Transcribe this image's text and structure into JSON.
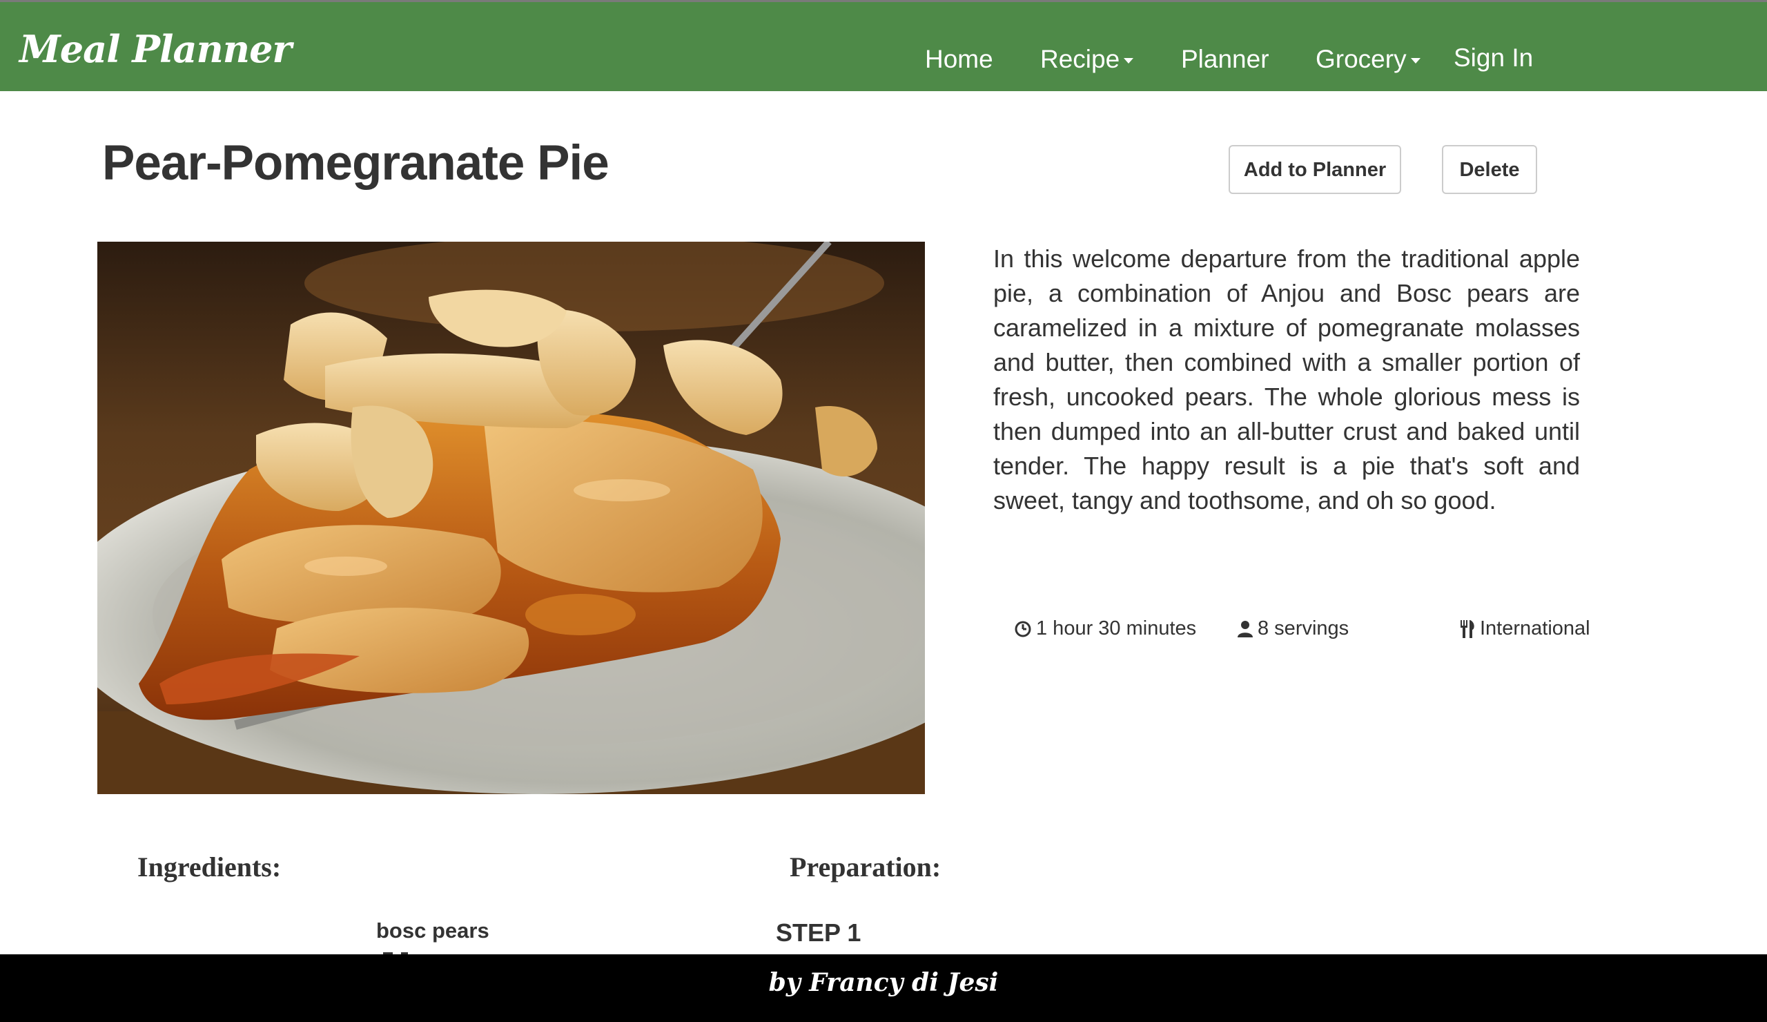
{
  "navbar": {
    "brand": "Meal Planner",
    "items": [
      {
        "label": "Home"
      },
      {
        "label": "Recipe"
      },
      {
        "label": "Planner"
      },
      {
        "label": "Grocery"
      },
      {
        "label": "Sign In"
      }
    ]
  },
  "recipe": {
    "title": "Pear-Pomegranate Pie",
    "add_button": "Add to Planner",
    "delete_button": "Delete",
    "description": "In this welcome departure from the traditional apple pie, a combination of Anjou and Bosc pears are caramelized in a mixture of pomegranate molasses and butter, then combined with a smaller portion of fresh, uncooked pears. The whole glorious mess is then dumped into an all-butter crust and baked until tender. The happy result is a pie that's soft and sweet, tangy and toothsome, and oh so good.",
    "time": "1 hour 30 minutes",
    "servings": "8 servings",
    "cuisine": "International",
    "image_icon": "pie-slice-photo"
  },
  "sections": {
    "ingredients_title": "Ingredients:",
    "preparation_title": "Preparation:",
    "ingredients": [
      "bosc pears"
    ],
    "steps": [
      "STEP 1"
    ]
  },
  "footer": {
    "credit": "by Francy di Jesi"
  },
  "colors": {
    "navbar": "#4e8a48",
    "footer": "#000000",
    "text": "#333333"
  }
}
